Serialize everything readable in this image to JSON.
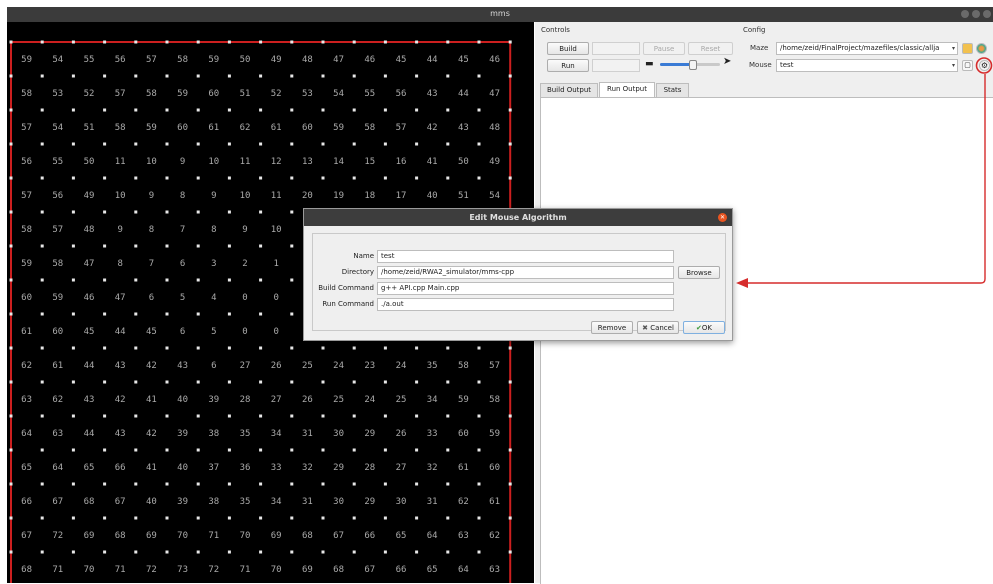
{
  "window": {
    "title": "mms"
  },
  "maze": {
    "rows": [
      [
        59,
        54,
        55,
        56,
        57,
        58,
        59,
        50,
        49,
        48,
        47,
        46,
        45,
        44,
        45,
        46
      ],
      [
        58,
        53,
        52,
        57,
        58,
        59,
        60,
        51,
        52,
        53,
        54,
        55,
        56,
        43,
        44,
        47
      ],
      [
        57,
        54,
        51,
        58,
        59,
        60,
        61,
        62,
        61,
        60,
        59,
        58,
        57,
        42,
        43,
        48
      ],
      [
        56,
        55,
        50,
        11,
        10,
        9,
        10,
        11,
        12,
        13,
        14,
        15,
        16,
        41,
        50,
        49
      ],
      [
        57,
        56,
        49,
        10,
        9,
        8,
        9,
        10,
        11,
        20,
        19,
        18,
        17,
        40,
        51,
        54
      ],
      [
        58,
        57,
        48,
        9,
        8,
        7,
        8,
        9,
        10,
        "",
        "",
        "",
        "",
        "",
        "",
        ""
      ],
      [
        59,
        58,
        47,
        8,
        7,
        6,
        3,
        2,
        1,
        "",
        "",
        "",
        "",
        "",
        "",
        ""
      ],
      [
        60,
        59,
        46,
        47,
        6,
        5,
        4,
        0,
        0,
        "",
        "",
        "",
        "",
        "",
        "",
        ""
      ],
      [
        61,
        60,
        45,
        44,
        45,
        6,
        5,
        0,
        0,
        "",
        "",
        "",
        "",
        "",
        "",
        ""
      ],
      [
        62,
        61,
        44,
        43,
        42,
        43,
        6,
        27,
        26,
        25,
        24,
        23,
        24,
        35,
        58,
        57
      ],
      [
        63,
        62,
        43,
        42,
        41,
        40,
        39,
        28,
        27,
        26,
        25,
        24,
        25,
        34,
        59,
        58
      ],
      [
        64,
        63,
        44,
        43,
        42,
        39,
        38,
        35,
        34,
        31,
        30,
        29,
        26,
        33,
        60,
        59
      ],
      [
        65,
        64,
        65,
        66,
        41,
        40,
        37,
        36,
        33,
        32,
        29,
        28,
        27,
        32,
        61,
        60
      ],
      [
        66,
        67,
        68,
        67,
        40,
        39,
        38,
        35,
        34,
        31,
        30,
        29,
        30,
        31,
        62,
        61
      ],
      [
        67,
        72,
        69,
        68,
        69,
        70,
        71,
        70,
        69,
        68,
        67,
        66,
        65,
        64,
        63,
        62
      ],
      [
        68,
        71,
        70,
        71,
        72,
        73,
        72,
        71,
        70,
        69,
        68,
        67,
        66,
        65,
        64,
        63
      ]
    ],
    "wall_color": "#cc1f1f",
    "post_color": "#e8e8e8",
    "text_color": "#aaaaaa"
  },
  "controls": {
    "heading": "Controls",
    "build_label": "Build",
    "run_label": "Run",
    "pause_label": "Pause",
    "reset_label": "Reset"
  },
  "config": {
    "heading": "Config",
    "maze_label": "Maze",
    "maze_value": "/home/zeid/FinalProject/mazefiles/classic/allja",
    "mouse_label": "Mouse",
    "mouse_value": "test"
  },
  "tabs": [
    "Build Output",
    "Run Output",
    "Stats"
  ],
  "active_tab": "Run Output",
  "dialog": {
    "title": "Edit Mouse Algorithm",
    "name_label": "Name",
    "name_value": "test",
    "dir_label": "Directory",
    "dir_value": "/home/zeid/RWA2_simulator/mms-cpp",
    "browse_label": "Browse",
    "build_label": "Build Command",
    "build_value": "g++ API.cpp Main.cpp",
    "run_label": "Run Command",
    "run_value": "./a.out",
    "remove_label": "Remove",
    "cancel_label": "Cancel",
    "ok_label": "OK"
  },
  "annotation_color": "#d62c2c"
}
